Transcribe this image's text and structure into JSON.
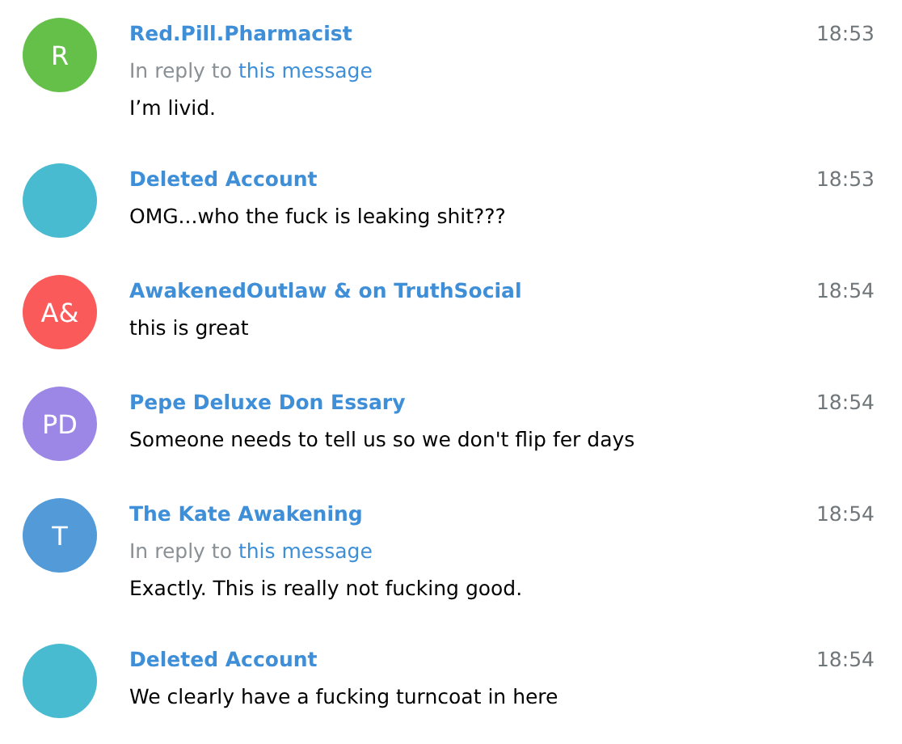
{
  "messages": [
    {
      "initials": "R",
      "color": "#65c04a",
      "name": "Red.Pill.Pharmacist",
      "time": "18:53",
      "reply": {
        "prefix": "In reply to",
        "link": "this message"
      },
      "text": "I’m livid."
    },
    {
      "color": "#48bbd0",
      "name": "Deleted Account",
      "time": "18:53",
      "text": "OMG...who the fuck is leaking shit???"
    },
    {
      "initials": "A&",
      "color": "#fa5a5a",
      "name": "AwakenedOutlaw & on TruthSocial",
      "time": "18:54",
      "text": "this is great"
    },
    {
      "initials": "PD",
      "color": "#9c87e6",
      "name": "Pepe Deluxe Don Essary",
      "time": "18:54",
      "text": "Someone needs to tell us so we don't flip fer days"
    },
    {
      "initials": "T",
      "color": "#529bd8",
      "name": "The Kate Awakening",
      "time": "18:54",
      "reply": {
        "prefix": "In reply to",
        "link": "this message"
      },
      "text": "Exactly. This is really not fucking good."
    },
    {
      "color": "#48bbd0",
      "name": "Deleted Account",
      "time": "18:54",
      "text": "We clearly have a fucking turncoat in here"
    }
  ]
}
